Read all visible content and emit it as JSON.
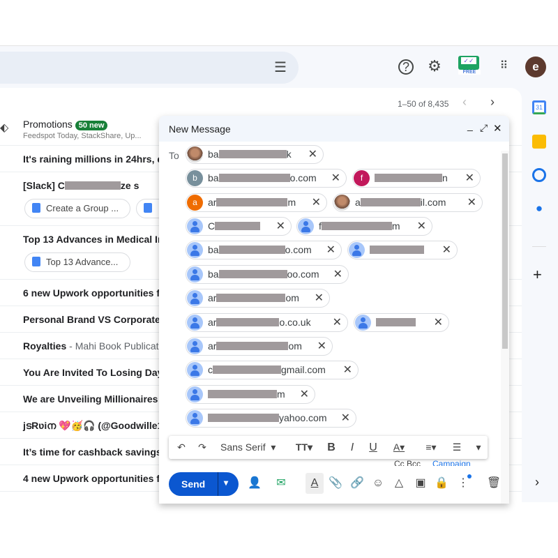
{
  "header": {
    "filter_icon": "tune-icon",
    "help_icon": "help-icon",
    "settings_icon": "gear-icon",
    "extension_badge": "FREE",
    "apps_icon": "apps-grid-icon",
    "avatar_letter": "e"
  },
  "pagination": {
    "range": "1–50 of 8,435"
  },
  "promotions": {
    "label": "Promotions",
    "badge": "50 new",
    "senders": "Feedspot Today, StackShare, Up..."
  },
  "emails": [
    {
      "subject": "It's raining millions in 24hrs, d",
      "snippet": ""
    },
    {
      "subject": "[Slack] C",
      "snippet": "",
      "subject_end": "ze s",
      "attachments": [
        "Create a Group ...",
        ""
      ]
    },
    {
      "subject": "Top 13 Advances in Medical Im",
      "snippet": "",
      "attachments": [
        "Top 13 Advance..."
      ]
    },
    {
      "subject": "6 new Upwork opportunities fo",
      "snippet": ""
    },
    {
      "subject": "Personal Brand VS Corporate",
      "snippet": ""
    },
    {
      "subject": "Royalties",
      "snippet": " - Mahi Book Publicati"
    },
    {
      "subject": "You Are Invited To Losing Dayl",
      "snippet": ""
    },
    {
      "subject": "We are Unveiling Millionaires i",
      "snippet": ""
    },
    {
      "subject": "jടRʋiന 💖🥳🎧 (@Goodwille1)",
      "snippet": ""
    },
    {
      "subject": "It’s time for cashback savings",
      "snippet": ""
    },
    {
      "subject": "4 new Upwork opportunities fo",
      "snippet": ""
    }
  ],
  "side_panel": {
    "items": [
      "calendar-icon",
      "keep-icon",
      "tasks-icon",
      "contacts-icon"
    ],
    "calendar_day": "31",
    "add_icon": "+",
    "expand_icon": "›"
  },
  "compose": {
    "title": "New Message",
    "to_label": "To",
    "recipients": [
      {
        "avatar": "photo",
        "letter": "",
        "prefix": "ba",
        "suffix": "k"
      },
      {
        "avatar": "letter",
        "letter": "b",
        "color": "#78909c",
        "prefix": "ba",
        "suffix": "o.com"
      },
      {
        "avatar": "letter",
        "letter": "f",
        "color": "#c2185b",
        "prefix": "",
        "suffix": "n"
      },
      {
        "avatar": "letter",
        "letter": "a",
        "color": "#ef6c00",
        "prefix": "ar",
        "suffix": "m"
      },
      {
        "avatar": "photo",
        "letter": "",
        "prefix": "a",
        "suffix": "il.com"
      },
      {
        "avatar": "person",
        "letter": "",
        "prefix": "C",
        "suffix": ""
      },
      {
        "avatar": "person",
        "letter": "",
        "prefix": "f",
        "suffix": "m"
      },
      {
        "avatar": "person",
        "letter": "",
        "prefix": "ba",
        "suffix": "o.com"
      },
      {
        "avatar": "person",
        "letter": "",
        "prefix": "",
        "suffix": ""
      },
      {
        "avatar": "person",
        "letter": "",
        "prefix": "ba",
        "suffix": "oo.com"
      },
      {
        "avatar": "person",
        "letter": "",
        "prefix": "ar",
        "suffix": "om"
      },
      {
        "avatar": "person",
        "letter": "",
        "prefix": "ar",
        "suffix": "o.co.uk"
      },
      {
        "avatar": "person",
        "letter": "",
        "prefix": "",
        "suffix": ""
      },
      {
        "avatar": "person",
        "letter": "",
        "prefix": "ar",
        "suffix": "om"
      },
      {
        "avatar": "person",
        "letter": "",
        "prefix": "c",
        "suffix": "gmail.com"
      },
      {
        "avatar": "person",
        "letter": "",
        "prefix": "",
        "suffix": "m"
      },
      {
        "avatar": "person",
        "letter": "",
        "prefix": "",
        "suffix": "yahoo.com"
      }
    ],
    "toolbar": {
      "font": "Sans Serif"
    },
    "cc_bcc": "Cc Bcc",
    "campaign": "Campaign",
    "send_label": "Send",
    "accent": "#0b57d0"
  }
}
